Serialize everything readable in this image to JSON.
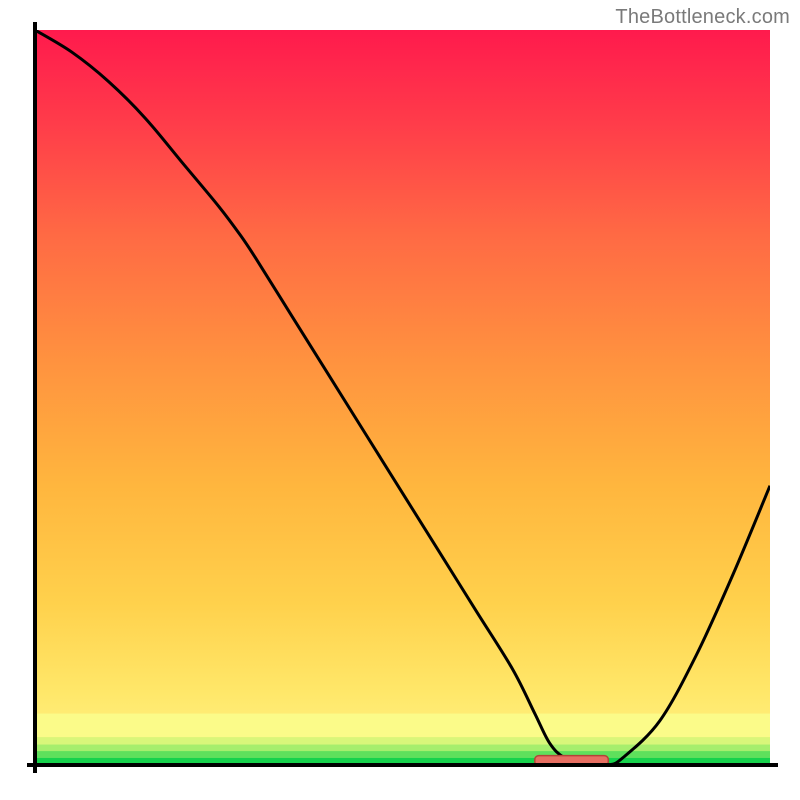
{
  "watermark": "TheBottleneck.com",
  "chart_data": {
    "type": "line",
    "title": "",
    "xlabel": "",
    "ylabel": "",
    "xlim": [
      0,
      100
    ],
    "ylim": [
      0,
      100
    ],
    "series": [
      {
        "name": "bottleneck-curve",
        "x": [
          0,
          5,
          10,
          15,
          20,
          25,
          28,
          30,
          35,
          40,
          45,
          50,
          55,
          60,
          65,
          68,
          70,
          72,
          75,
          78,
          80,
          85,
          90,
          95,
          100
        ],
        "y": [
          100,
          97,
          93,
          88,
          82,
          76,
          72,
          69,
          61,
          53,
          45,
          37,
          29,
          21,
          13,
          7,
          3,
          1,
          0,
          0,
          1,
          6,
          15,
          26,
          38
        ]
      }
    ],
    "horizontal_bands": [
      {
        "name": "green",
        "y0": 0.0,
        "y1": 1.0,
        "color": "#17d24c"
      },
      {
        "name": "green-light",
        "y0": 1.0,
        "y1": 1.9,
        "color": "#5fe05c"
      },
      {
        "name": "lime",
        "y0": 1.9,
        "y1": 2.8,
        "color": "#a6ee6d"
      },
      {
        "name": "yellow-pale",
        "y0": 2.8,
        "y1": 3.8,
        "color": "#d9f67a"
      },
      {
        "name": "yellow-light",
        "y0": 3.8,
        "y1": 7.0,
        "color": "#fbfb89"
      }
    ],
    "gradient_top_color": "#ff1a4d",
    "gradient_bottom_color": "#fff58b",
    "marker": {
      "x0": 68,
      "x1": 78,
      "y": 0.6,
      "fill": "#e76f62",
      "stroke": "#b24437"
    },
    "axis_stroke": "#000000",
    "axis_width": 4,
    "curve_stroke": "#000000",
    "curve_width": 3
  }
}
